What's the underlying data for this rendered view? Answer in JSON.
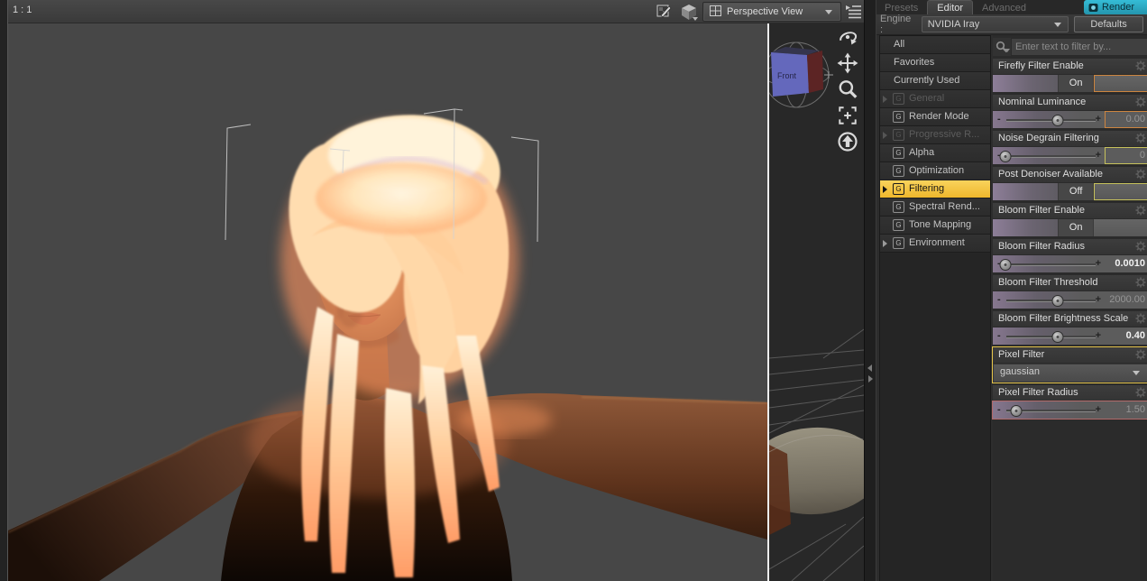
{
  "viewport": {
    "zoom_ratio": "1 : 1",
    "camera_selector": "Perspective View",
    "view_cube_label": "Front",
    "tools": [
      "orbit",
      "pan",
      "zoom",
      "frame",
      "home"
    ]
  },
  "ui": {
    "minus": "-",
    "plus": "+",
    "group_letter": "G"
  },
  "panel": {
    "tabs": [
      {
        "label": "Presets",
        "active": false
      },
      {
        "label": "Editor",
        "active": true
      },
      {
        "label": "Advanced",
        "active": false
      }
    ],
    "render_button": "Render",
    "engine_label": "Engine :",
    "engine_value": "NVIDIA Iray",
    "defaults_button": "Defaults",
    "search_placeholder": "Enter text to filter by...",
    "categories": [
      {
        "label": "All"
      },
      {
        "label": "Favorites"
      },
      {
        "label": "Currently Used"
      },
      {
        "label": "General",
        "dimmed": true,
        "arrow": true
      },
      {
        "label": "Render Mode"
      },
      {
        "label": "Progressive R...",
        "dimmed": true,
        "arrow": true
      },
      {
        "label": "Alpha"
      },
      {
        "label": "Optimization"
      },
      {
        "label": "Filtering",
        "selected": true,
        "arrow": true
      },
      {
        "label": "Spectral Rend..."
      },
      {
        "label": "Tone Mapping"
      },
      {
        "label": "Environment",
        "arrow": true
      }
    ],
    "parameters": [
      {
        "name": "Firefly Filter Enable",
        "type": "toggle",
        "value": "On",
        "highlight": "orange"
      },
      {
        "name": "Nominal Luminance",
        "type": "slider",
        "value": "0.00",
        "highlight": "orange"
      },
      {
        "name": "Noise Degrain Filtering",
        "type": "slider",
        "value": "0",
        "highlight": "yellow"
      },
      {
        "name": "Post Denoiser Available",
        "type": "toggle",
        "value": "Off",
        "highlight": "yellow"
      },
      {
        "name": "Bloom Filter Enable",
        "type": "toggle",
        "value": "On",
        "highlight": "none"
      },
      {
        "name": "Bloom Filter Radius",
        "type": "slider",
        "value": "0.0010",
        "highlight": "none"
      },
      {
        "name": "Bloom Filter Threshold",
        "type": "slider",
        "value": "2000.00",
        "highlight": "none"
      },
      {
        "name": "Bloom Filter Brightness Scale",
        "type": "slider",
        "value": "0.40",
        "highlight": "none"
      },
      {
        "name": "Pixel Filter",
        "type": "dropdown",
        "value": "gaussian",
        "highlight": "yellow-outline"
      },
      {
        "name": "Pixel Filter Radius",
        "type": "slider",
        "value": "1.50",
        "highlight": "red-row"
      }
    ]
  }
}
